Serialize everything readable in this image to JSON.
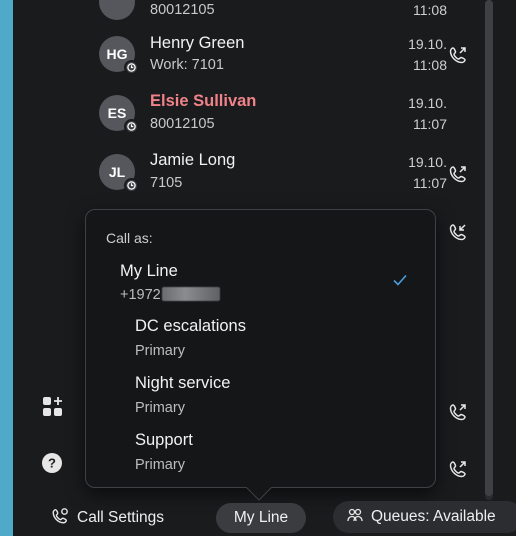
{
  "history": {
    "rows": [
      {
        "initials": "",
        "name": "",
        "number": "80012105",
        "date": "",
        "time": "11:08",
        "missed": false
      },
      {
        "initials": "HG",
        "name": "Henry Green",
        "number": "Work: 7101",
        "date": "19.10.",
        "time": "11:08",
        "missed": false
      },
      {
        "initials": "ES",
        "name": "Elsie Sullivan",
        "number": "80012105",
        "date": "19.10.",
        "time": "11:07",
        "missed": true
      },
      {
        "initials": "JL",
        "name": "Jamie Long",
        "number": "7105",
        "date": "19.10.",
        "time": "11:07",
        "missed": false
      }
    ]
  },
  "popup": {
    "title": "Call as:",
    "options": [
      {
        "name": "My Line",
        "sub": "+1972",
        "selected": true
      },
      {
        "name": "DC escalations",
        "sub": "Primary"
      },
      {
        "name": "Night service",
        "sub": "Primary"
      },
      {
        "name": "Support",
        "sub": "Primary"
      }
    ]
  },
  "footer": {
    "call_settings": "Call Settings",
    "my_line": "My Line",
    "queues": "Queues: Available"
  },
  "colors": {
    "background": "#1a1b1d",
    "missed": "#f0838a",
    "check": "#4a9fe0",
    "outer": "#4fa9c9"
  },
  "icons": [
    "clock-icon",
    "callback-icon",
    "add-widget-icon",
    "help-icon",
    "call-settings-icon",
    "queues-icon",
    "checkmark-icon"
  ]
}
